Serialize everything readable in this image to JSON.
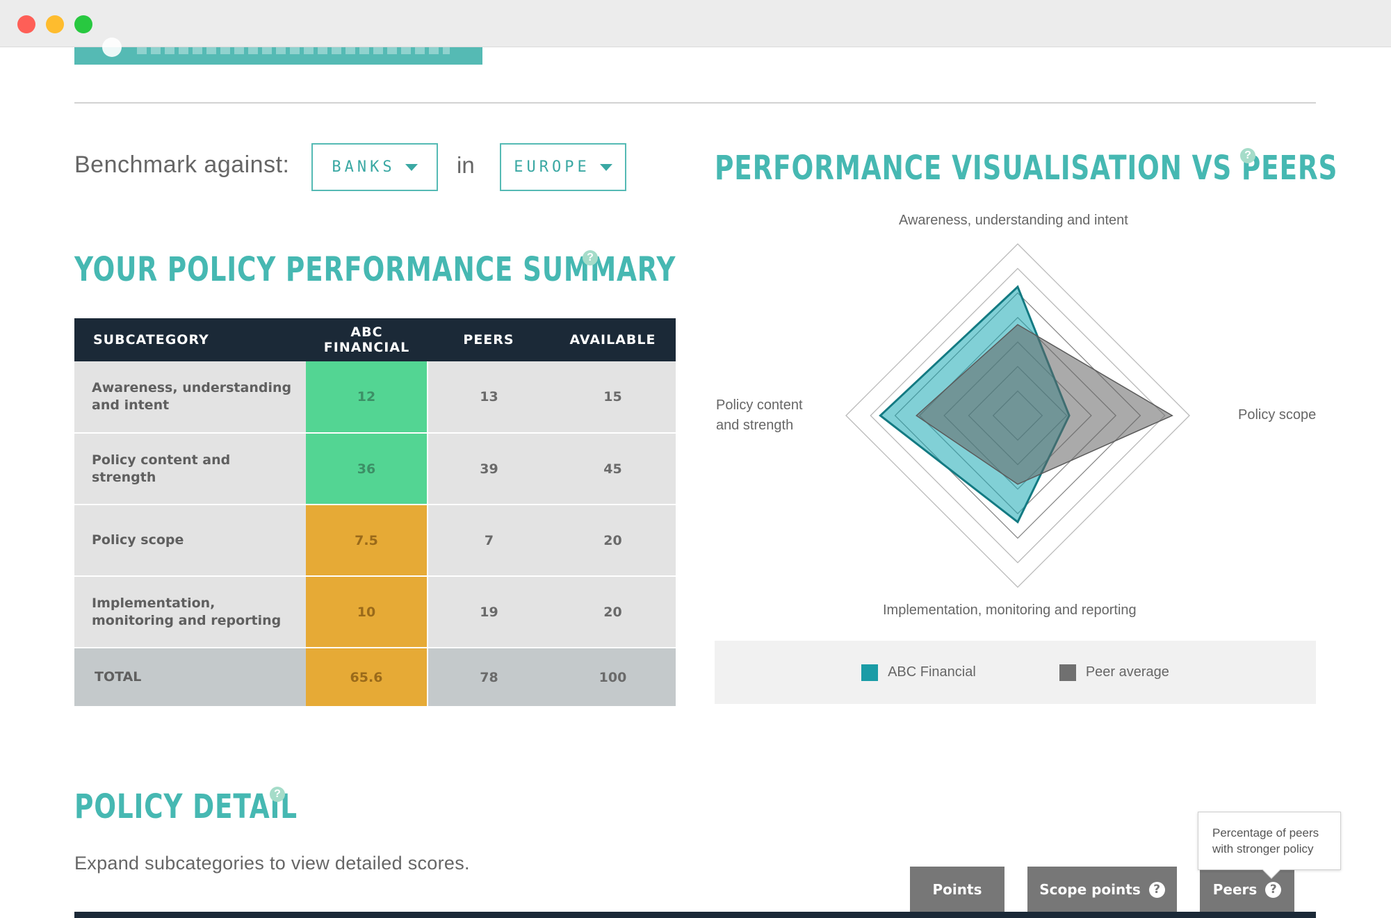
{
  "benchmark": {
    "label": "Benchmark against:",
    "sector": "BANKS",
    "connector": "in",
    "region": "EUROPE"
  },
  "summary": {
    "title": "YOUR POLICY PERFORMANCE SUMMARY",
    "columns": [
      "SUBCATEGORY",
      "ABC FINANCIAL",
      "PEERS",
      "AVAILABLE"
    ],
    "rows": [
      {
        "subcategory": "Awareness, understanding and intent",
        "abc": "12",
        "peers": "13",
        "available": "15",
        "status": "green"
      },
      {
        "subcategory": "Policy content and strength",
        "abc": "36",
        "peers": "39",
        "available": "45",
        "status": "green"
      },
      {
        "subcategory": "Policy scope",
        "abc": "7.5",
        "peers": "7",
        "available": "20",
        "status": "amber"
      },
      {
        "subcategory": "Implementation, monitoring and reporting",
        "abc": "10",
        "peers": "19",
        "available": "20",
        "status": "amber"
      }
    ],
    "total": {
      "label": "TOTAL",
      "abc": "65.6",
      "peers": "78",
      "available": "100"
    }
  },
  "visualisation": {
    "title": "PERFORMANCE VISUALISATION vs PEERS",
    "axes": {
      "top": "Awareness, understanding and intent",
      "right": "Policy scope",
      "bottom": "Implementation, monitoring and reporting",
      "left_line1": "Policy content",
      "left_line2": "and strength"
    },
    "legend": [
      {
        "label": "ABC Financial",
        "color": "#1a9ca6"
      },
      {
        "label": "Peer average",
        "color": "#707070"
      }
    ]
  },
  "chart_data": {
    "type": "radar",
    "axes": [
      "Awareness, understanding and intent",
      "Policy scope",
      "Implementation, monitoring and reporting",
      "Policy content and strength"
    ],
    "series": [
      {
        "name": "ABC Financial",
        "values": [
          0.75,
          0.3,
          0.62,
          0.8
        ],
        "color": "#1a9ca6"
      },
      {
        "name": "Peer average",
        "values": [
          0.53,
          0.9,
          0.4,
          0.59
        ],
        "color": "#707070"
      }
    ],
    "rings": 7
  },
  "detail": {
    "title": "POLICY DETAIL",
    "subtitle": "Expand subcategories to view detailed scores.",
    "tabs": {
      "points": "Points",
      "scope_points": "Scope points",
      "peers": "Peers"
    },
    "tooltip_line1": "Percentage of peers",
    "tooltip_line2": "with stronger policy"
  },
  "colors": {
    "accent": "#46b8b2",
    "header_dark": "#1b2937",
    "green": "#53d593",
    "amber": "#e6aa36"
  }
}
